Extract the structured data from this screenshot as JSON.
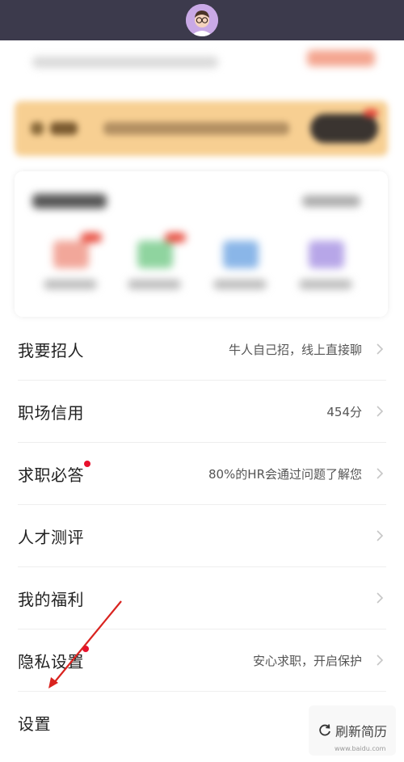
{
  "menu": {
    "items": [
      {
        "title": "我要招人",
        "value": "牛人自己招，线上直接聊",
        "badge": false
      },
      {
        "title": "职场信用",
        "value": "454分",
        "badge": false
      },
      {
        "title": "求职必答",
        "value": "80%的HR会通过问题了解您",
        "badge": true
      },
      {
        "title": "人才测评",
        "value": "",
        "badge": false
      },
      {
        "title": "我的福利",
        "value": "",
        "badge": false
      },
      {
        "title": "隐私设置",
        "value": "安心求职，开启保护",
        "badge": true
      },
      {
        "title": "设置",
        "value": "",
        "badge": false
      }
    ]
  },
  "floating": {
    "refresh_label": "刷新简历",
    "icon": "refresh-icon"
  },
  "watermark": "www.baidu.com",
  "colors": {
    "topbar": "#3c3a4c",
    "banner": "#f7cf92",
    "badge": "#e8112d",
    "annotation_arrow": "#d9231f"
  }
}
